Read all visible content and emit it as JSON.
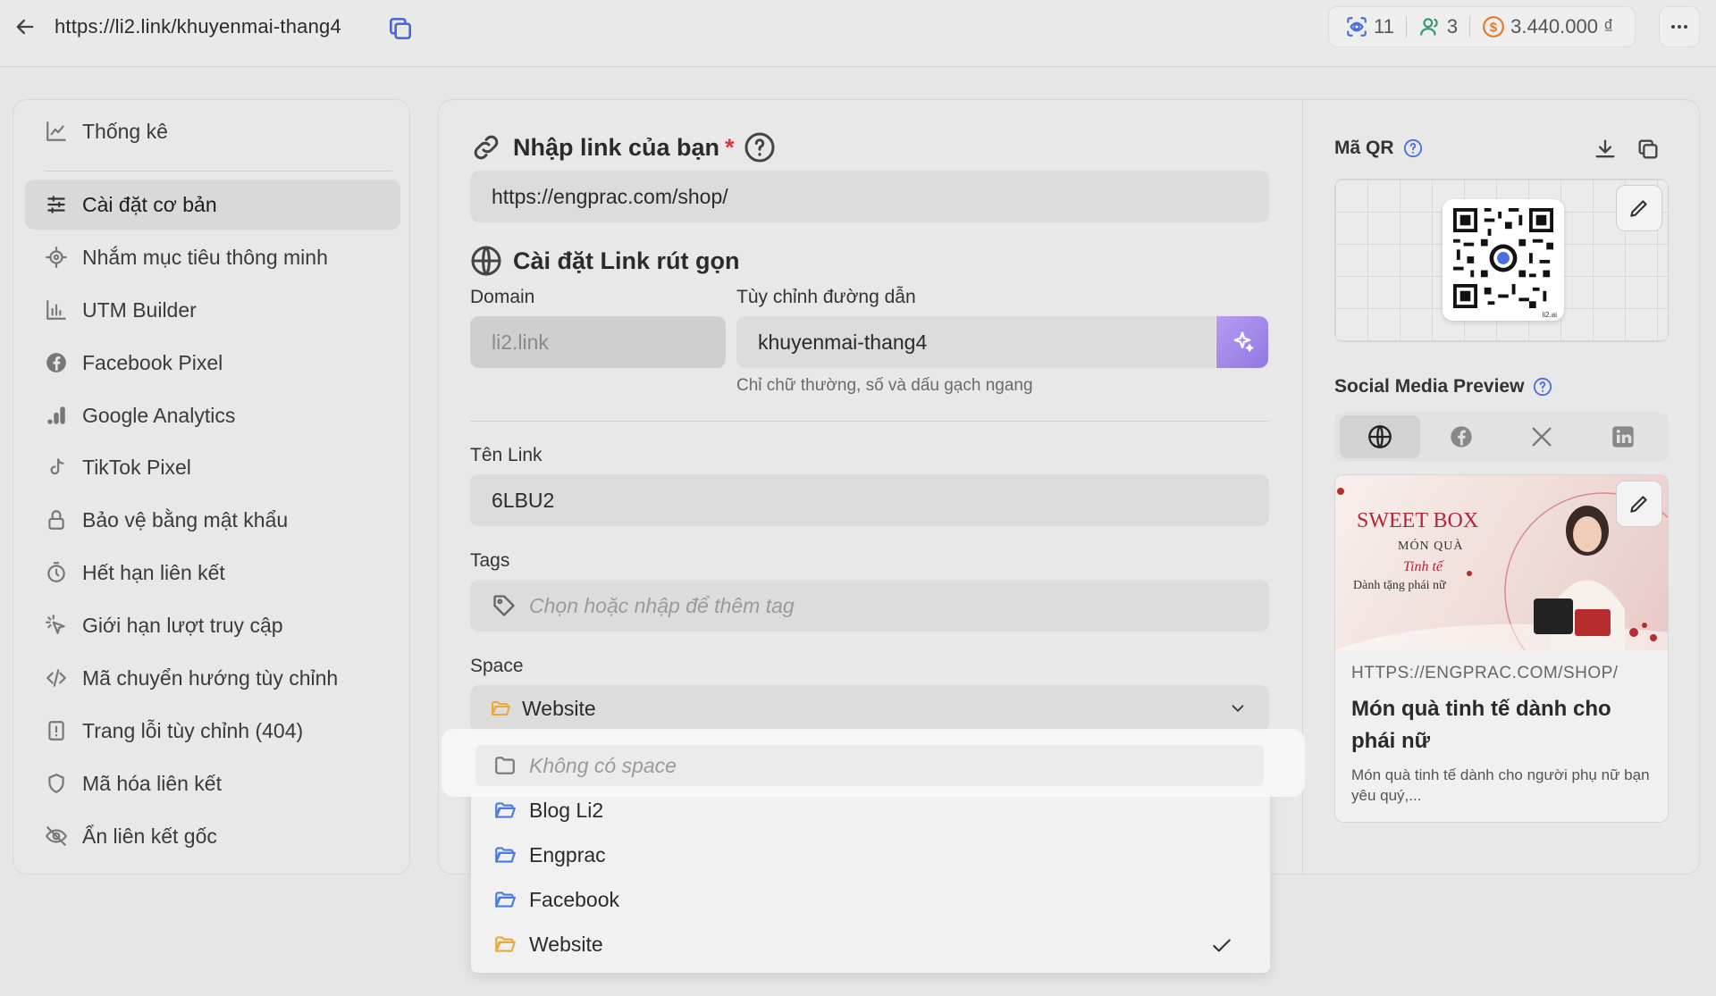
{
  "topbar": {
    "url": "https://li2.link/khuyenmai-thang4",
    "stats": {
      "clicks": "11",
      "users": "3",
      "revenue": "3.440.000 ₫"
    }
  },
  "sidebar": {
    "items": [
      {
        "label": "Thống kê",
        "icon": "chart-line-icon"
      },
      {
        "label": "Cài đặt cơ bản",
        "icon": "sliders-icon",
        "active": true
      },
      {
        "label": "Nhắm mục tiêu thông minh",
        "icon": "target-icon"
      },
      {
        "label": "UTM Builder",
        "icon": "bar-chart-icon"
      },
      {
        "label": "Facebook Pixel",
        "icon": "facebook-icon"
      },
      {
        "label": "Google Analytics",
        "icon": "analytics-icon"
      },
      {
        "label": "TikTok Pixel",
        "icon": "tiktok-icon"
      },
      {
        "label": "Bảo vệ bằng mật khẩu",
        "icon": "lock-icon"
      },
      {
        "label": "Hết hạn liên kết",
        "icon": "timer-icon"
      },
      {
        "label": "Giới hạn lượt truy cập",
        "icon": "pointer-icon"
      },
      {
        "label": "Mã chuyển hướng tùy chỉnh",
        "icon": "code-icon"
      },
      {
        "label": "Trang lỗi tùy chỉnh (404)",
        "icon": "alert-file-icon"
      },
      {
        "label": "Mã hóa liên kết",
        "icon": "shield-icon"
      },
      {
        "label": "Ẩn liên kết gốc",
        "icon": "eye-off-icon"
      }
    ]
  },
  "form": {
    "link_title": "Nhập link của bạn",
    "required_mark": "*",
    "link_value": "https://engprac.com/shop/",
    "short_title": "Cài đặt Link rút gọn",
    "domain_label": "Domain",
    "domain_value": "li2.link",
    "path_label": "Tùy chỉnh đường dẫn",
    "path_value": "khuyenmai-thang4",
    "path_hint": "Chỉ chữ thường, số và dấu gạch ngang",
    "name_label": "Tên Link",
    "name_value": "6LBU2",
    "tags_label": "Tags",
    "tags_placeholder": "Chọn hoặc nhập để thêm tag",
    "space_label": "Space",
    "space_value": "Website"
  },
  "dropdown": {
    "options": [
      {
        "label": "Không có space",
        "color": "#777777"
      },
      {
        "label": "Blog Li2",
        "color": "#4a7be0"
      },
      {
        "label": "Engprac",
        "color": "#4a7be0"
      },
      {
        "label": "Facebook",
        "color": "#4a7be0"
      },
      {
        "label": "Website",
        "color": "#e8a93a",
        "selected": true
      }
    ]
  },
  "right": {
    "qr_title": "Mã QR",
    "qr_caption": "li2.ai",
    "preview_title": "Social Media Preview",
    "tabs": [
      "globe-icon",
      "facebook-icon",
      "x-icon",
      "linkedin-icon"
    ],
    "image_text": {
      "brand": "SWEET BOX",
      "line1": "MÓN QUÀ",
      "line2": "Tinh tế",
      "line3": "Dành tặng phái nữ"
    },
    "card_url": "HTTPS://ENGPRAC.COM/SHOP/",
    "card_title": "Món quà tinh tế dành cho phái nữ",
    "card_desc": "Món quà tinh tế dành cho người phụ nữ bạn yêu quý,..."
  },
  "colors": {
    "accent": "#4a6de0",
    "required": "#d63a3a",
    "ai_button": "#9a82e8",
    "revenue": "#e07a2a"
  }
}
